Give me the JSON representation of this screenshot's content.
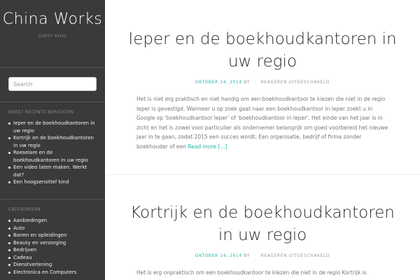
{
  "site": {
    "title": "China Works",
    "description": "GUEST BLOG"
  },
  "search": {
    "placeholder": "Search"
  },
  "recent_posts": {
    "title": "MEEST RECENTE BERICHTEN",
    "items": [
      "Ieper en de boekhoudkantoren in uw regio",
      "Kortrijk en de boekhoudkantoren in uw regio",
      "Roeselare en de boekhoudkantoren in uw regio",
      "Een video laten maken. Werkt dat?",
      "Een hoogsensitief kind"
    ]
  },
  "categories": {
    "title": "CATEGORIEEN",
    "items": [
      "Aanbiedingen",
      "Auto",
      "Banen en opleidingen",
      "Beauty en verzorging",
      "Bedrijven",
      "Cadeau",
      "Dienstverlening",
      "Electronica en Computers"
    ]
  },
  "posts": [
    {
      "title": "Ieper en de boekhoudkantoren in uw regio",
      "date": "OKTOBER 14, 2014",
      "by": "BY",
      "comments": "REAGEREN UITGESCHAKELD",
      "excerpt": "Het is niet erg praktisch en niet handig om een boekhoudkantoor te kiezen die niet in de regio Ieper is gevestigd. Wanneer u op zoek gaat naar een boekhoudkantoor in Ieper zoekt u in Google op 'boekhoudkantoor Ieper' of 'boekhoudkantoor in Ieper'. Het einde van het jaar is in zicht en het is zowel voor particulier als ondernemer belangrijk om goed voorbereid het nieuwe jaar in te gaan, zodat 2015 een succes wordt. Een organisatie, bedrijf of firma zonder boekhouder of een ",
      "read_more": "Read more [...]"
    },
    {
      "title": "Kortrijk en de boekhoudkantoren in uw regio",
      "date": "OKTOBER 14, 2014",
      "by": "BY",
      "comments": "REAGEREN UITGESCHAKELD",
      "excerpt": "Het is erg onpraktisch om een boekhoudkantoor te kiezen die niet in de regio Kortrijk is gevestigd. Wanneer u op zoek gaat naar een boekhoudkantoor in Kortrijk zoekt u in Google"
    }
  ],
  "colors": {
    "accent": "#1fb5a7",
    "sidebar_bg": "#3a3a3a"
  }
}
